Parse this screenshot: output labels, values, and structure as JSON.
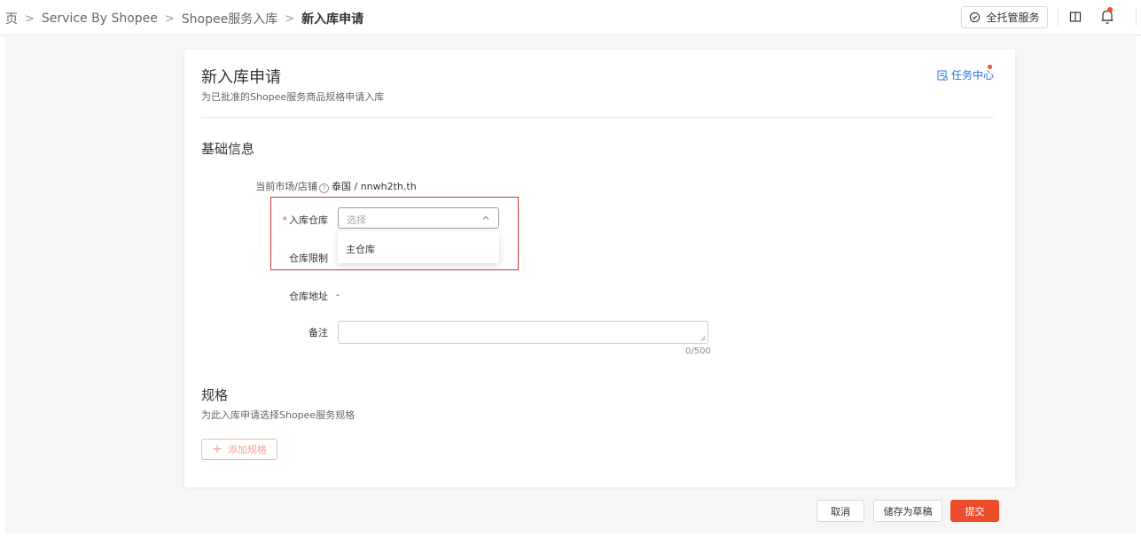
{
  "breadcrumb": {
    "items": [
      "页",
      "Service By Shopee",
      "Shopee服务入库"
    ],
    "current": "新入库申请"
  },
  "header": {
    "managed_service_label": "全托管服务"
  },
  "card": {
    "title": "新入库申请",
    "subtitle": "为已批准的Shopee服务商品规格申请入库",
    "task_center_label": "任务中心"
  },
  "basic_info": {
    "section_title": "基础信息",
    "market_store_label": "当前市场/店铺",
    "market_store_value": "泰国 / nnwh2th.th",
    "warehouse_label": "入库仓库",
    "warehouse_placeholder": "选择",
    "warehouse_options": [
      "主仓库"
    ],
    "warehouse_limit_label": "仓库限制",
    "warehouse_address_label": "仓库地址",
    "warehouse_address_value": "-",
    "remark_label": "备注",
    "remark_value": "",
    "remark_counter": "0/500"
  },
  "specs": {
    "section_title": "规格",
    "subtitle": "为此入库申请选择Shopee服务规格",
    "add_button_label": "添加规格"
  },
  "footer": {
    "cancel_label": "取消",
    "save_draft_label": "储存为草稿",
    "submit_label": "提交"
  },
  "colors": {
    "brand": "#ee4d2d",
    "link": "#2673dd",
    "highlight_border": "#d0342c"
  }
}
